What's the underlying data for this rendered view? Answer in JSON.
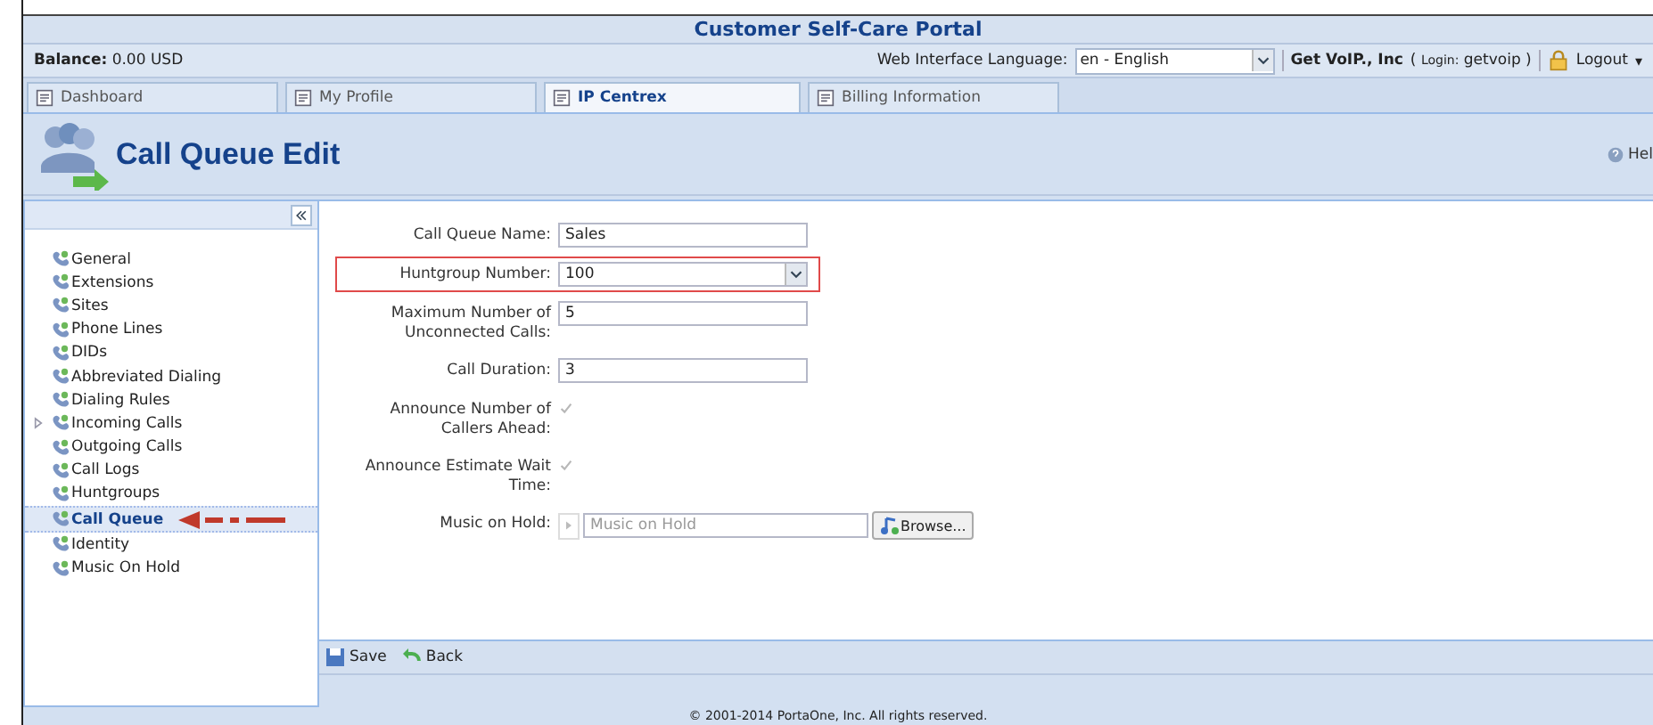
{
  "window": {
    "title": "Customer Self-Care Portal"
  },
  "info_bar": {
    "balance_label": "Balance:",
    "balance_value": "0.00 USD",
    "language_label": "Web Interface Language:",
    "language_value": "en - English",
    "company": "Get VoIP., Inc",
    "login_prefix": "( ",
    "login_label": "Login:",
    "login_value": "getvoip )",
    "logout": "Logout",
    "logout_caret": "▾"
  },
  "tabs": [
    {
      "label": "Dashboard",
      "selected": false
    },
    {
      "label": "My Profile",
      "selected": false
    },
    {
      "label": "IP Centrex",
      "selected": true
    },
    {
      "label": "Billing Information",
      "selected": false
    }
  ],
  "header": {
    "title": "Call Queue Edit",
    "help": "Hel"
  },
  "sidebar": {
    "items": [
      {
        "label": "General",
        "selected": false,
        "has_children": false
      },
      {
        "label": "Extensions",
        "selected": false,
        "has_children": false
      },
      {
        "label": "Sites",
        "selected": false,
        "has_children": false
      },
      {
        "label": "Phone Lines",
        "selected": false,
        "has_children": false
      },
      {
        "label": "DIDs",
        "selected": false,
        "has_children": false
      },
      {
        "label": "Abbreviated Dialing",
        "selected": false,
        "has_children": false
      },
      {
        "label": "Dialing Rules",
        "selected": false,
        "has_children": false
      },
      {
        "label": "Incoming Calls",
        "selected": false,
        "has_children": true
      },
      {
        "label": "Outgoing Calls",
        "selected": false,
        "has_children": false
      },
      {
        "label": "Call Logs",
        "selected": false,
        "has_children": false
      },
      {
        "label": "Huntgroups",
        "selected": false,
        "has_children": false
      },
      {
        "label": "Call Queue",
        "selected": true,
        "has_children": false,
        "pointed_at": true
      },
      {
        "label": "Identity",
        "selected": false,
        "has_children": false
      },
      {
        "label": "Music On Hold",
        "selected": false,
        "has_children": false
      }
    ]
  },
  "form": {
    "fields": [
      {
        "kind": "text",
        "label": "Call Queue Name:",
        "value": "Sales",
        "highlighted": false
      },
      {
        "kind": "select",
        "label": "Huntgroup Number:",
        "value": "100",
        "highlighted": true
      },
      {
        "kind": "text",
        "label": "Maximum Number of Unconnected Calls:",
        "value": "5",
        "highlighted": false
      },
      {
        "kind": "text",
        "label": "Call Duration:",
        "value": "3",
        "highlighted": false
      },
      {
        "kind": "checkbox",
        "label": "Announce Number of Callers Ahead:",
        "checked": true,
        "disabled": true,
        "highlighted": false
      },
      {
        "kind": "checkbox",
        "label": "Announce Estimate Wait Time:",
        "checked": true,
        "disabled": true,
        "highlighted": false
      },
      {
        "kind": "file",
        "label": "Music on Hold:",
        "placeholder": "Music on Hold",
        "button": "Browse...",
        "highlighted": false
      }
    ]
  },
  "toolbar": {
    "buttons": [
      "Save",
      "Back"
    ]
  },
  "footer": "© 2001-2014 PortaOne, Inc. All rights reserved."
}
